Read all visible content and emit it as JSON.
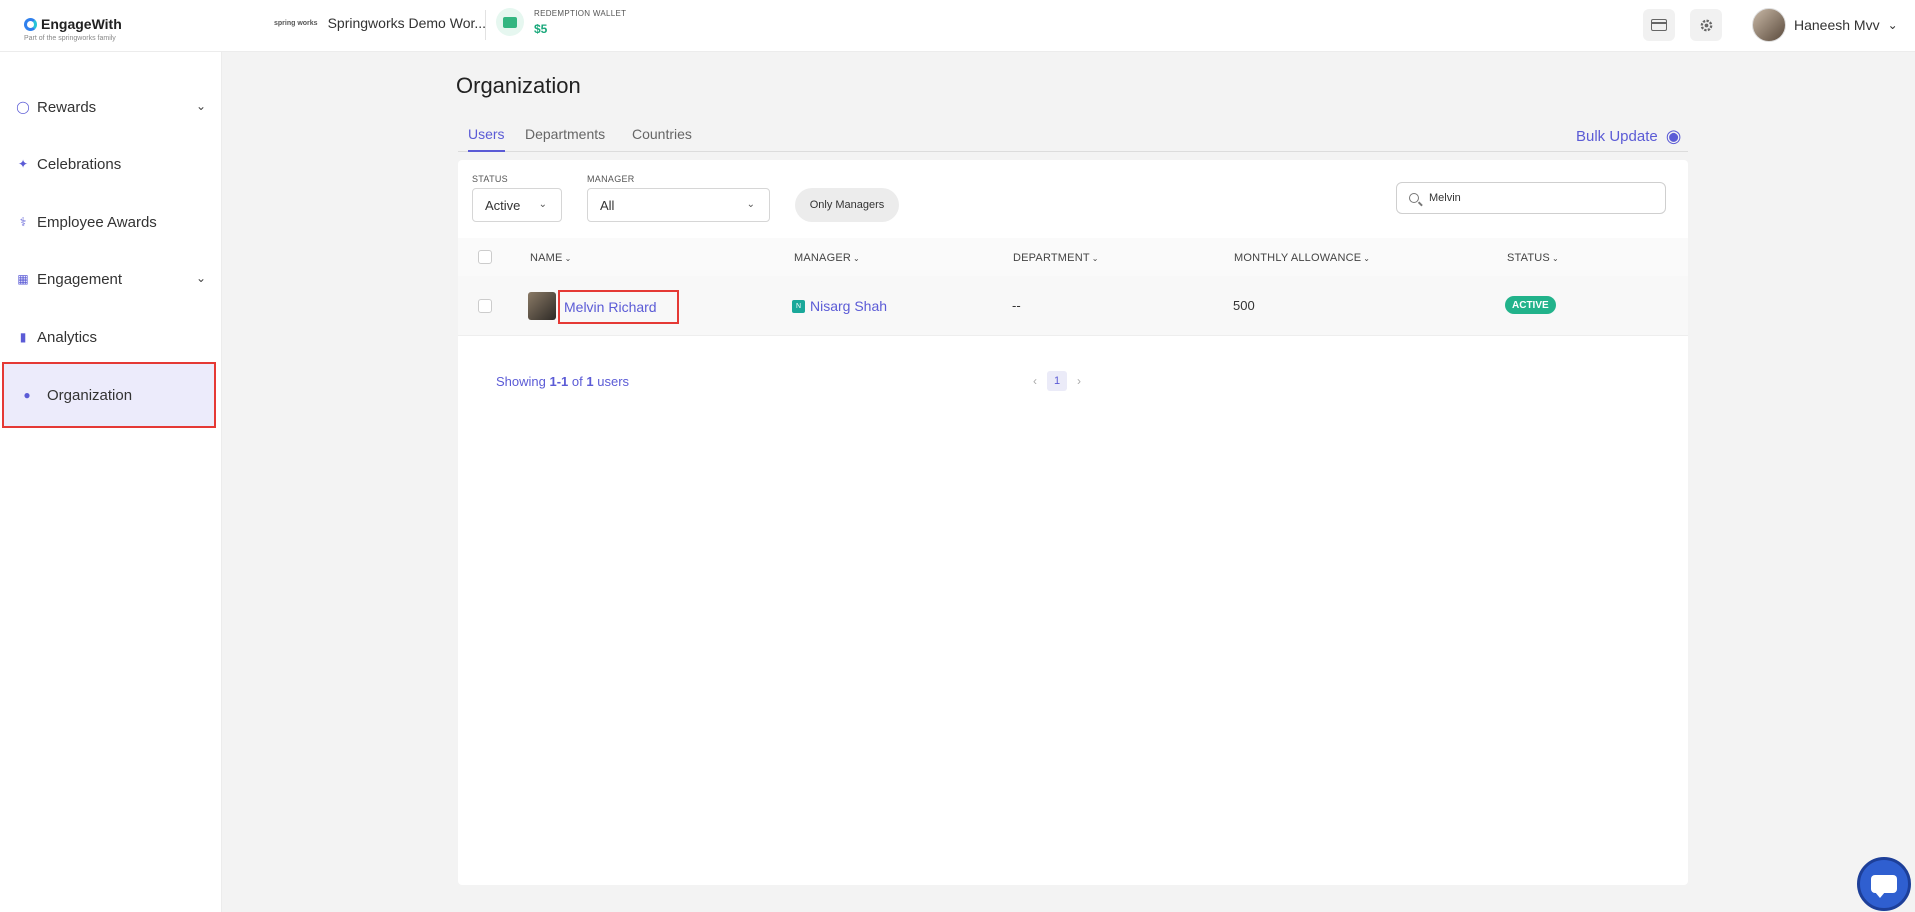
{
  "app": {
    "logo_text": "EngageWith",
    "logo_subtext": "Part of the springworks family",
    "workspace_name": "Springworks Demo Wor...",
    "workspace_logo_text": "spring works",
    "wallet_label": "REDEMPTION WALLET",
    "wallet_value": "$5",
    "user_name": "Haneesh Mvv"
  },
  "sidebar": {
    "items": [
      {
        "label": "Rewards",
        "icon": "medal-icon",
        "has_chevron": true
      },
      {
        "label": "Celebrations",
        "icon": "party-popper-icon",
        "has_chevron": false
      },
      {
        "label": "Employee Awards",
        "icon": "trophy-icon",
        "has_chevron": false
      },
      {
        "label": "Engagement",
        "icon": "engagement-icon",
        "has_chevron": true
      },
      {
        "label": "Analytics",
        "icon": "bar-chart-icon",
        "has_chevron": false
      },
      {
        "label": "Organization",
        "icon": "people-group-icon",
        "has_chevron": false,
        "active": true
      }
    ]
  },
  "main": {
    "title": "Organization",
    "tabs": [
      {
        "label": "Users",
        "active": true
      },
      {
        "label": "Departments",
        "active": false
      },
      {
        "label": "Countries",
        "active": false
      }
    ],
    "bulk_update_label": "Bulk Update",
    "filters": {
      "status_label": "STATUS",
      "status_value": "Active",
      "manager_label": "MANAGER",
      "manager_value": "All",
      "only_managers_label": "Only Managers",
      "search_value": "Melvin"
    },
    "table": {
      "columns": [
        "NAME",
        "MANAGER",
        "DEPARTMENT",
        "MONTHLY ALLOWANCE",
        "STATUS"
      ],
      "rows": [
        {
          "name": "Melvin Richard",
          "manager_initial": "N",
          "manager": "Nisarg Shah",
          "department": "--",
          "monthly_allowance": "500",
          "status": "ACTIVE"
        }
      ]
    },
    "pagination": {
      "showing_prefix": "Showing",
      "range": "1-1",
      "of": "of",
      "total": "1",
      "suffix": "users",
      "current_page": "1"
    }
  },
  "colors": {
    "accent": "#5b5bd6",
    "status_active": "#22b38b",
    "highlight_border": "#e53935"
  }
}
